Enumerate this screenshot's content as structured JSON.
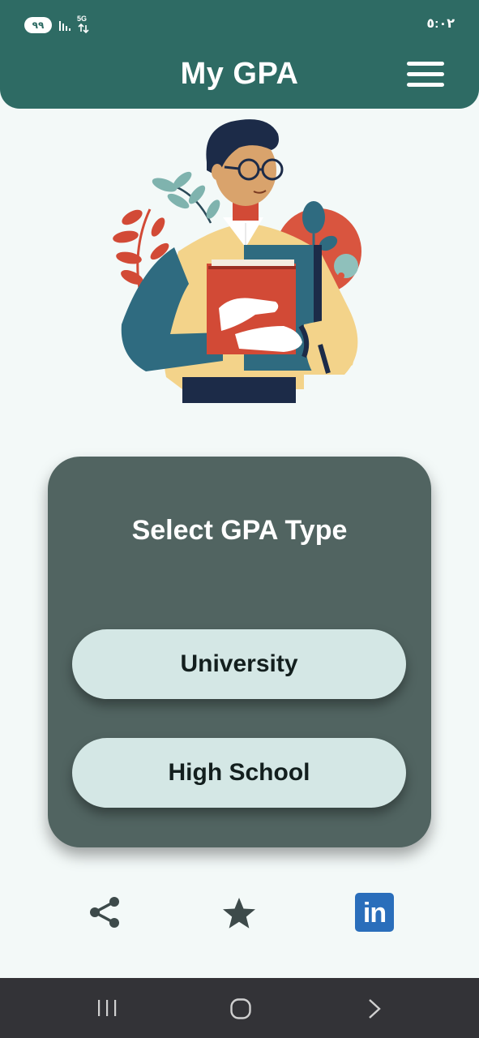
{
  "status_bar": {
    "battery": "٩٩",
    "network": "5G",
    "time": "٥:٠٢"
  },
  "header": {
    "title": "My GPA",
    "menu_icon": "hamburger-menu-icon"
  },
  "illustration": {
    "description_icon": "student-holding-books-illustration"
  },
  "card": {
    "title": "Select GPA Type",
    "options": [
      {
        "label": "University"
      },
      {
        "label": "High School"
      }
    ]
  },
  "bottom_actions": {
    "share_icon": "share-icon",
    "rate_icon": "star-icon",
    "linkedin_label": "in"
  },
  "nav_bar": {
    "recents_icon": "recents-icon",
    "home_icon": "home-icon",
    "back_icon": "back-icon"
  },
  "colors": {
    "primary": "#2e6b64",
    "card": "#516461",
    "button": "#d4e7e5",
    "background": "#f3f9f8",
    "linkedin": "#2a6ebb"
  }
}
